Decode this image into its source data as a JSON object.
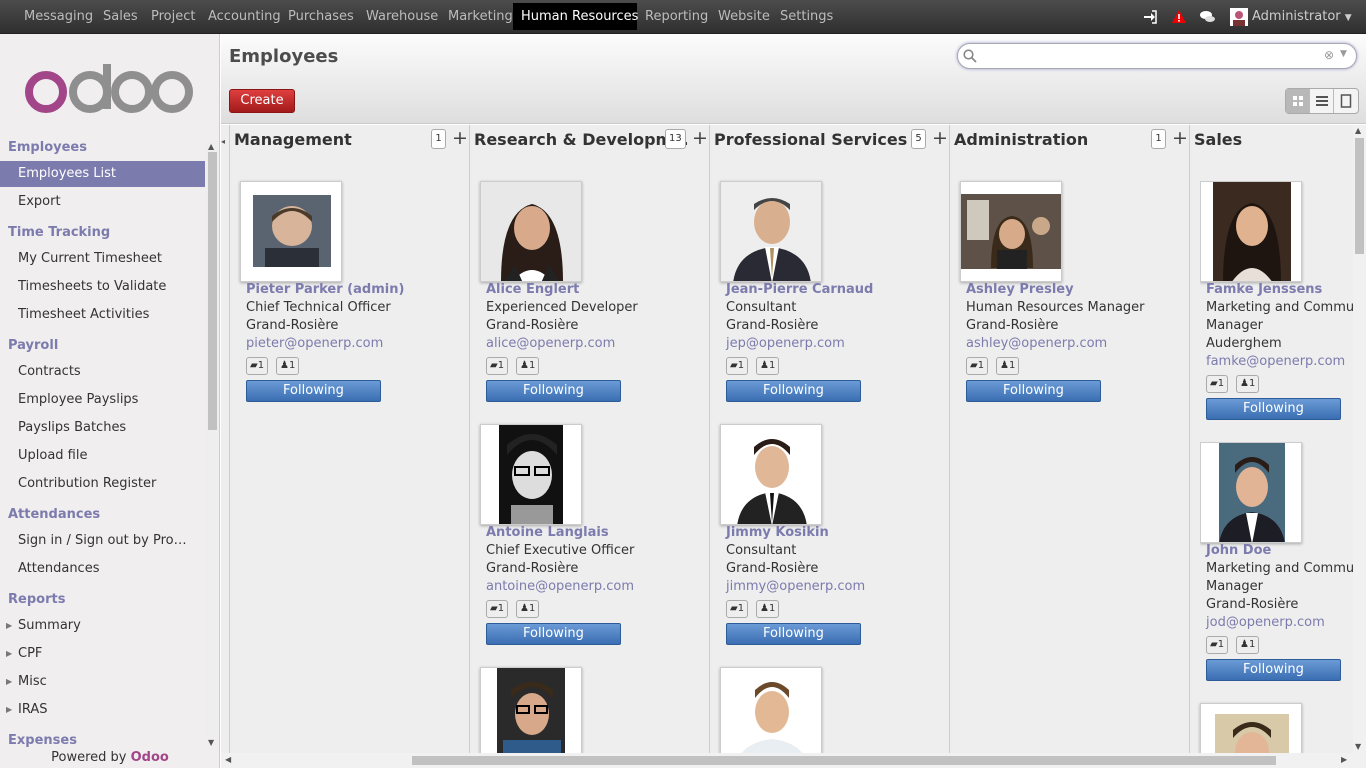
{
  "topbar": {
    "menu": [
      "Messaging",
      "Sales",
      "Project",
      "Accounting",
      "Purchases",
      "Warehouse",
      "Marketing",
      "Human Resources",
      "Reporting",
      "Website",
      "Settings"
    ],
    "active_menu": "Human Resources",
    "user": "Administrator"
  },
  "sidebar": {
    "logo_text": "odoo",
    "sections": [
      {
        "title": "Employees",
        "items": [
          "Employees List",
          "Export"
        ]
      },
      {
        "title": "Time Tracking",
        "items": [
          "My Current Timesheet",
          "Timesheets to Validate",
          "Timesheet Activities"
        ]
      },
      {
        "title": "Payroll",
        "items": [
          "Contracts",
          "Employee Payslips",
          "Payslips Batches",
          "Upload file",
          "Contribution Register"
        ]
      },
      {
        "title": "Attendances",
        "items": [
          "Sign in / Sign out by Pro…",
          "Attendances"
        ]
      },
      {
        "title": "Reports",
        "items": [
          "Summary",
          "CPF",
          "Misc",
          "IRAS"
        ]
      },
      {
        "title": "Expenses",
        "items": []
      }
    ],
    "active_item": "Employees List",
    "powered_prefix": "Powered by",
    "powered_brand": "Odoo"
  },
  "header": {
    "title": "Employees",
    "search_value": "",
    "create_label": "Create"
  },
  "board": {
    "follow_label": "Following",
    "columns": [
      {
        "title": "Management",
        "count": "1",
        "cards": [
          {
            "name": "Pieter Parker (admin)",
            "job": [
              "Chief Technical Officer"
            ],
            "location": "Grand-Rosière",
            "email": "pieter@openerp.com",
            "messages": "1",
            "followers": "1"
          }
        ]
      },
      {
        "title": "Research & Developm…",
        "count": "13",
        "cards": [
          {
            "name": "Alice Englert",
            "job": [
              "Experienced Developer"
            ],
            "location": "Grand-Rosière",
            "email": "alice@openerp.com",
            "messages": "1",
            "followers": "1"
          },
          {
            "name": "Antoine Langlais",
            "job": [
              "Chief Executive Officer"
            ],
            "location": "Grand-Rosière",
            "email": "antoine@openerp.com",
            "messages": "1",
            "followers": "1"
          }
        ]
      },
      {
        "title": "Professional Services",
        "count": "5",
        "cards": [
          {
            "name": "Jean-Pierre Carnaud",
            "job": [
              "Consultant"
            ],
            "location": "Grand-Rosière",
            "email": "jep@openerp.com",
            "messages": "1",
            "followers": "1"
          },
          {
            "name": "Jimmy Kosikin",
            "job": [
              "Consultant"
            ],
            "location": "Grand-Rosière",
            "email": "jimmy@openerp.com",
            "messages": "1",
            "followers": "1"
          }
        ]
      },
      {
        "title": "Administration",
        "count": "1",
        "cards": [
          {
            "name": "Ashley Presley",
            "job": [
              "Human Resources Manager"
            ],
            "location": "Grand-Rosière",
            "email": "ashley@openerp.com",
            "messages": "1",
            "followers": "1"
          }
        ]
      },
      {
        "title": "Sales",
        "count": "",
        "cards": [
          {
            "name": "Famke Jenssens",
            "job": [
              "Marketing and Communi",
              "Manager"
            ],
            "location": "Auderghem",
            "email": "famke@openerp.com",
            "messages": "1",
            "followers": "1"
          },
          {
            "name": "John Doe",
            "job": [
              "Marketing and Communi",
              "Manager"
            ],
            "location": "Grand-Rosière",
            "email": "jod@openerp.com",
            "messages": "1",
            "followers": "1"
          }
        ]
      }
    ]
  }
}
